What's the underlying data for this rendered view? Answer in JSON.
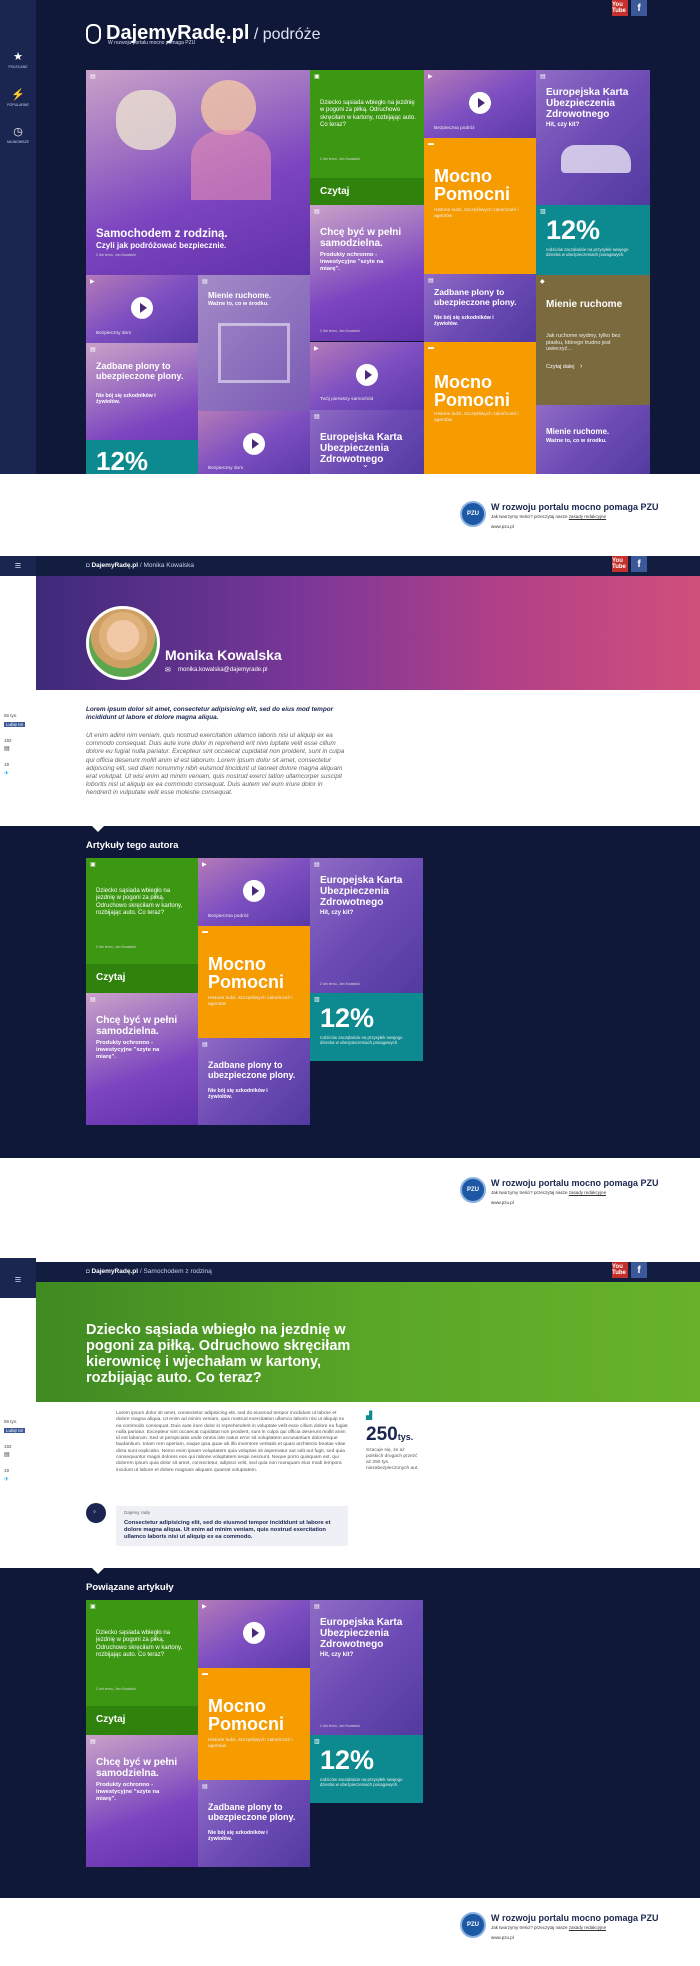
{
  "brand": {
    "name": "DajemyRadę.pl",
    "section": "/ podróże",
    "tagline": "W rozwoju portalu mocno pomaga PZU"
  },
  "social": {
    "yt": "You Tube",
    "fb": "f"
  },
  "sidebar": {
    "items": [
      {
        "label": "Polecane",
        "icon": "star-icon"
      },
      {
        "label": "Popularne",
        "icon": "flame-icon"
      },
      {
        "label": "Najnowsze",
        "icon": "clock-icon"
      }
    ]
  },
  "tiles": {
    "hero_title": "Samochodem z rodziną.",
    "hero_sub": "Czyli jak podróżować bezpiecznie.",
    "hero_meta": "2 dni temu, Jan Kowalski",
    "kid_text": "Dziecko sąsiada wbiegło na jezdnię w pogoni za piłką. Odruchowo skręciłam w kartony, rozbijając auto. Co teraz?",
    "kid_meta": "2 dni temu, Jan Kowalski",
    "read": "Czytaj",
    "video1": "Bezpieczna podróż",
    "ekuz_title": "Europejska Karta Ubezpieczenia Zdrowotnego",
    "ekuz_sub": "Hit, czy kit?",
    "ekuz_meta": "2 dni temu, Jan Kowalski",
    "mp_title1": "Mocno",
    "mp_title2": "Pomocni",
    "mp_sub": "Historie ludzi, szczęśliwych zakończeń i agentów",
    "pct": "12%",
    "pct_sub": "rodziców zaczęłaście na przysyłek swojego dziecka w ubezpieczeniach posagowych.",
    "chce_title": "Chcę być w pełni samodzielna.",
    "chce_sub": "Produkty ochronno -inwestycyjne \"szyte na miarę\".",
    "chce_meta": "2 dni temu, Jan Kowalski",
    "zad_title": "Zadbane plony to ubezpieczone plony.",
    "zad_sub": "Nie bój się szkodników i żywiołów.",
    "mienie_title": "Mienie ruchome.",
    "mienie_sub": "Ważne to, co w środku.",
    "mienie2_title": "Mienie ruchome",
    "mienie2_body": "Jak ruchome wydmy, tylko bez piasku, którego trudno jest uwierzyć...",
    "mienie2_cta": "Czytaj dalej",
    "video2": "Bezpieczny dom",
    "video3": "Twój pierwszy samochód",
    "video4": "Bezpieczny dom",
    "mienie3_title": "Mienie ruchome.",
    "mienie3_sub": "Ważne to, co w środku."
  },
  "footer": {
    "title": "W rozwoju portalu mocno pomaga PZU",
    "sub": "Jak tworzymy treści? przeczytaj nasze",
    "link": "zasady redakcyjne",
    "url": "www.pzu.pl"
  },
  "author_page": {
    "crumb_brand": "DajemyRadę.pl",
    "crumb_path": "/ Monika Kowalska",
    "name": "Monika Kowalska",
    "email": "monika.kowalska@dajemyrade.pl",
    "share_likes": "56 tys.",
    "share_like": "Lubię to!",
    "share_g": "192",
    "share_t": "19",
    "lead": "Lorem ipsum dolor sit amet, consectetur adipisicing elit, sed do eius mod tempor incididunt ut labore et dolore magna aliqua.",
    "body": "Ut enim adimi nim veniam, quis nostrud exercitation ullamco laboris nisi ut aliquip ex ea commodo consequat. Duis aute irure dolor in reprehend erit nivo luptate velit esse cillum dolore eu fugiat nulla pariatur. Excepteur sint occaecat cupidatat non proident, sunt in culpa qui officia deserunt mollit anim id est laborum. Lorem ipsum dolor sit amet, consectetur adipiscing elit, sed diam nonummy nibh euismod tincidunt ut laoreet dolore magna aliquam erat volutpat. Ut wisi enim ad minim veniam, quis nostrud exerci tation ullamcorper suscipit lobortis nisl ut aliquip ex ea commodo consequat. Duis autem vel eum iriure dolor in hendrerit in vulputate velit esse molestie consequat.",
    "section": "Artykuły tego autora"
  },
  "article_page": {
    "crumb_brand": "DajemyRadę.pl",
    "crumb_path": "/ Samochodem z rodziną",
    "title": "Dziecko sąsiada wbiegło na jezdnię w pogoni za piłką. Odruchowo skręciłam kierownicę i wjechałam w kartony, rozbijając auto. Co teraz?",
    "share_likes": "56 tys.",
    "share_like": "Lubię to!",
    "share_g": "192",
    "share_t": "19",
    "body": "Lorem ipsum dolor sit amet, consectetur adipisicing elit, sed do eiusmod tempor incididunt ut labore et dolore magna aliqua. Ut enim ad minim veniam, quis nostrud exercitation ullamco laboris nisi ut aliquip ex ea commodo consequat. Duis aute irure dolor in reprehenderit in voluptate velit esse cillum dolore eu fugiat nulla pariatur. Excepteur sint occaecat cupidatat non proident, sunt in culpa qui officia deserunt mollit anim id est laborum. Sed ut perspiciatis unde omnis iste natus error sit voluptatem accusantium doloremque laudantium, totam rem aperiam, eaque ipsa quae ab illo inventore veritatis et quasi architecto beatae vitae dicta sunt explicabo. Nemo enim ipsam voluptatem quia voluptas sit aspernatur aut odit aut fugit, sed quia consequuntur magni dolores eos qui ratione voluptatem sequi nesciunt. Neque porro quisquam est, qui dolorem ipsum quia dolor sit amet, consectetur, adipisci velit, sed quia non numquam eius modi tempora incidunt ut labore et dolore magnam aliquam quaerat voluptatem.",
    "stat_num": "250",
    "stat_unit": "tys.",
    "stat_desc": "Szacuje się, że aż polskich drogach przeżć aż 250 tys. niezabezpieczonych aut.",
    "tip_label": "Dajemy radę",
    "tip_text": "Consectetur adipisicing elit, sed do eiusmod tempor incididunt ut labore et dolore magna aliqua. Ut enim ad minim veniam, quis nostrud exercitation ullamco laboris nisi ut aliquip ex ea commodo.",
    "section": "Powiązane artykuły"
  },
  "colors": {
    "navy": "#0f1838",
    "green": "#3c9712",
    "orange": "#f69b00",
    "teal": "#0d8a8f",
    "purple": "#6a35b0"
  }
}
